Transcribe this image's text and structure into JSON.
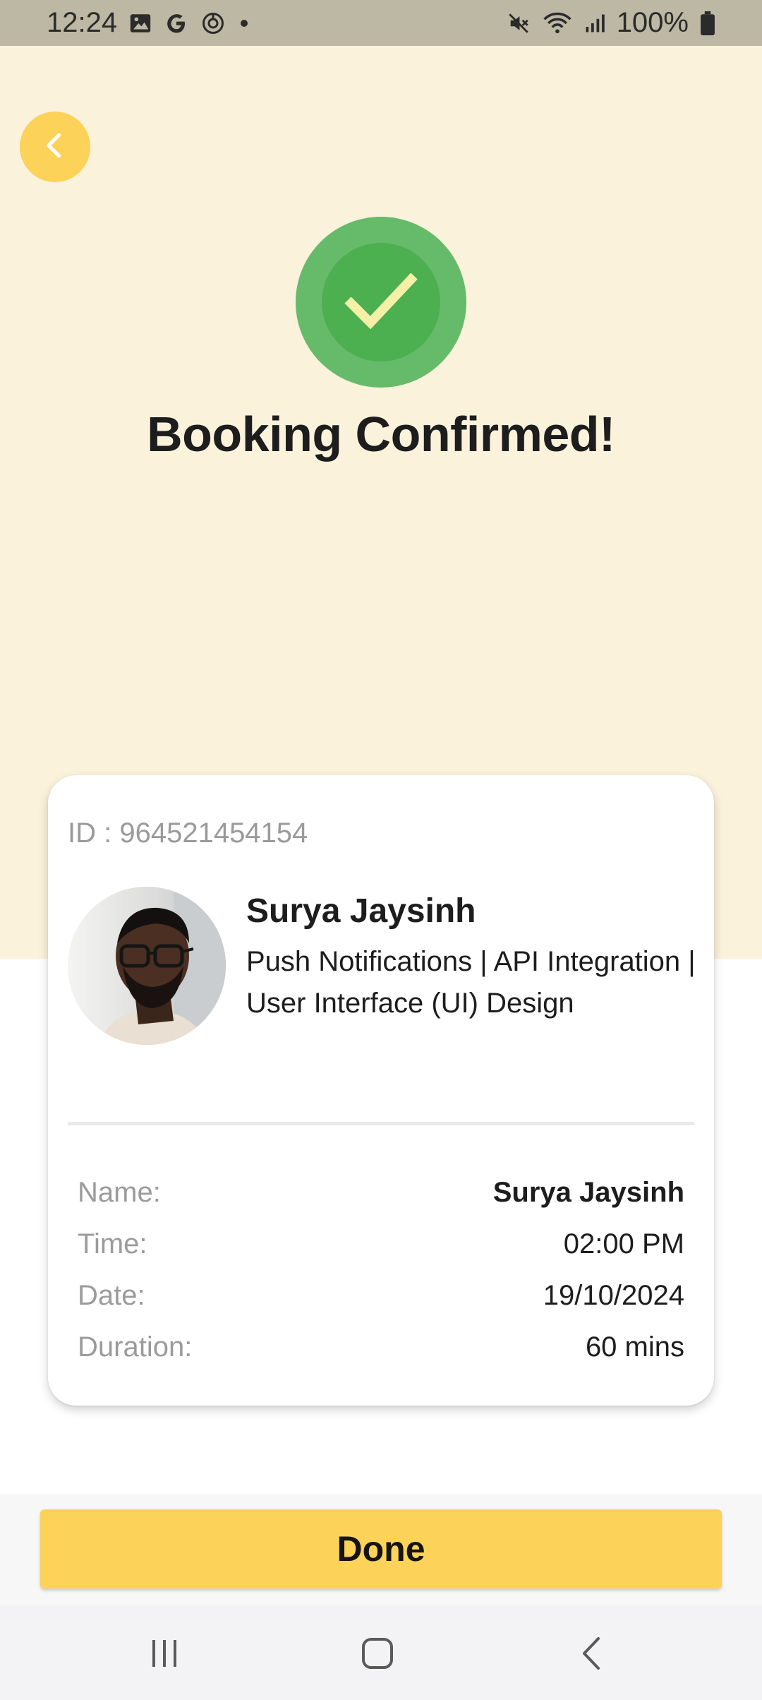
{
  "status_bar": {
    "time": "12:24",
    "battery": "100%",
    "left_icons": [
      "image-icon",
      "google-g-icon",
      "data-saver-icon",
      "dot-icon"
    ],
    "right_icons": [
      "mute-icon",
      "wifi-icon",
      "signal-icon",
      "battery-icon"
    ]
  },
  "header": {
    "back_icon": "chevron-left-icon",
    "success_icon": "checkmark-icon",
    "title": "Booking Confirmed!"
  },
  "booking": {
    "id_text": "ID : 964521454154",
    "mentor": {
      "name": "Surya Jaysinh",
      "skills": "Push Notifications | API Integration | User Interface (UI) Design"
    },
    "details": [
      {
        "label": "Name:",
        "value": "Surya Jaysinh"
      },
      {
        "label": "Time:",
        "value": "02:00 PM"
      },
      {
        "label": "Date:",
        "value": "19/10/2024"
      },
      {
        "label": "Duration:",
        "value": "60 mins"
      }
    ]
  },
  "actions": {
    "done_label": "Done"
  },
  "nav": {
    "icons": [
      "recent-apps-icon",
      "home-icon",
      "back-icon"
    ]
  },
  "colors": {
    "accent_yellow": "#FCD358",
    "top_background": "#FAF2DB",
    "success_outer": "#66BB6A",
    "success_inner": "#4CAF50",
    "check_color": "#F5F0A8"
  }
}
